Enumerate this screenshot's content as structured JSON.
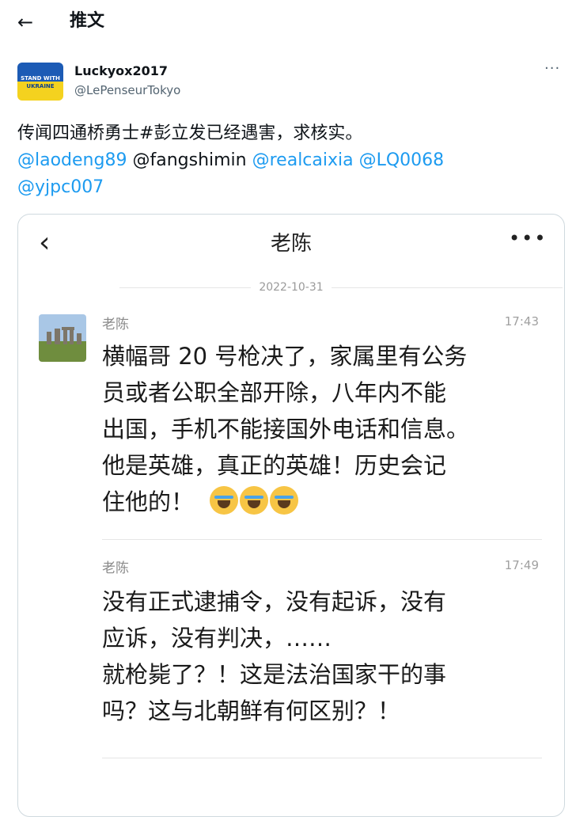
{
  "header": {
    "back_icon": "arrow-left-icon",
    "title": "推文"
  },
  "author": {
    "avatar_line1": "STAND WITH",
    "avatar_line2": "UKRAINE",
    "name": "Luckyox2017",
    "handle": "@LePenseurTokyo",
    "more_label": "···"
  },
  "tweet": {
    "text": "传闻四通桥勇士#彭立发已经遇害，求核实。",
    "mentions": [
      "@laodeng89",
      "@fangshimin",
      "@realcaixia",
      "@LQ0068",
      "@yjpc007"
    ]
  },
  "chat": {
    "back_icon": "chevron-left-icon",
    "title": "老陈",
    "more_label": "•••",
    "date": "2022-10-31",
    "messages": [
      {
        "sender": "老陈",
        "time": "17:43",
        "lines": [
          "横幅哥 20 号枪决了，家属里有公务",
          "员或者公职全部开除，八年内不能",
          "出国，手机不能接国外电话和信息。",
          "他是英雄，真正的英雄！历史会记",
          "住他的！"
        ],
        "emoji": "loudly-crying-face-icon"
      },
      {
        "sender": "老陈",
        "time": "17:49",
        "lines": [
          "没有正式逮捕令，没有起诉，没有",
          "应诉，没有判决，……",
          "就枪毙了？！这是法治国家干的事",
          "吗？这与北朝鲜有何区别？！"
        ]
      }
    ]
  }
}
